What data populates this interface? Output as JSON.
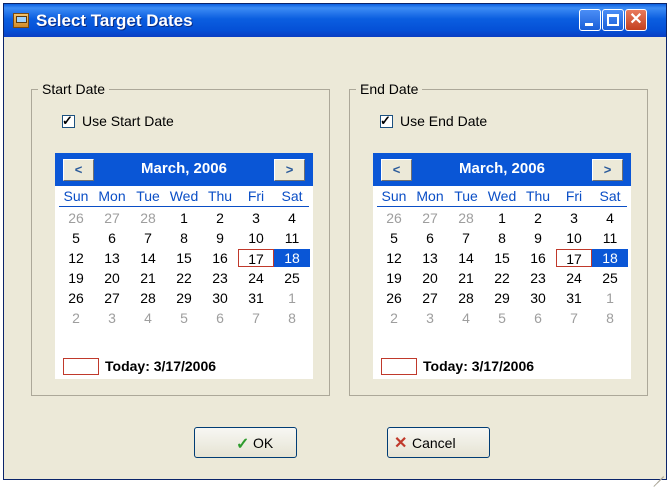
{
  "window": {
    "title": "Select Target Dates"
  },
  "start": {
    "group_label": "Start Date",
    "checkbox_label": "Use Start Date",
    "checked": true,
    "month_title": "March, 2006",
    "today_label": "Today: 3/17/2006"
  },
  "end": {
    "group_label": "End Date",
    "checkbox_label": "Use End Date",
    "checked": true,
    "month_title": "March, 2006",
    "today_label": "Today: 3/17/2006"
  },
  "calendar": {
    "weekdays": [
      "Sun",
      "Mon",
      "Tue",
      "Wed",
      "Thu",
      "Fri",
      "Sat"
    ],
    "weeks": [
      [
        "26",
        "27",
        "28",
        "1",
        "2",
        "3",
        "4"
      ],
      [
        "5",
        "6",
        "7",
        "8",
        "9",
        "10",
        "11"
      ],
      [
        "12",
        "13",
        "14",
        "15",
        "16",
        "17",
        "18"
      ],
      [
        "19",
        "20",
        "21",
        "22",
        "23",
        "24",
        "25"
      ],
      [
        "26",
        "27",
        "28",
        "29",
        "30",
        "31",
        "1"
      ],
      [
        "2",
        "3",
        "4",
        "5",
        "6",
        "7",
        "8"
      ]
    ],
    "today_day": "17",
    "selected_day": "18"
  },
  "buttons": {
    "ok_label": "OK",
    "cancel_label": "Cancel"
  },
  "colors": {
    "titlebar": "#0a56d6",
    "header": "#0a56d6",
    "selected_bg": "#0a56d6",
    "today_border": "#c0392b",
    "other_month_text": "#9e9e9e"
  },
  "icons": {
    "app": "app-icon",
    "minimize": "minimize-icon",
    "maximize": "maximize-icon",
    "close": "close-icon",
    "prev": "chevron-left-icon",
    "next": "chevron-right-icon",
    "ok": "checkmark-icon",
    "cancel": "x-icon"
  }
}
